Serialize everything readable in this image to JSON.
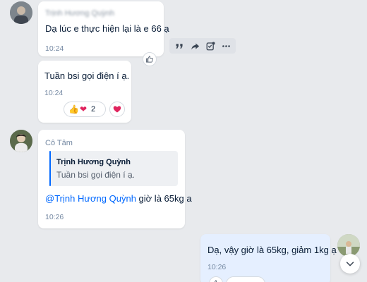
{
  "messages": [
    {
      "sender": "Trịnh Hương Quỳnh",
      "text": "Dạ lúc e thực hiện lại là e 66 ạ",
      "time": "10:24"
    },
    {
      "text": "Tuần bsi gọi điện í ạ.",
      "time": "10:24",
      "reaction_count": "2",
      "reaction_emojis": [
        "👍",
        "❤"
      ]
    },
    {
      "sender": "Cô Tâm",
      "quote_author": "Trịnh Hương Quỳnh",
      "quote_text": "Tuần bsi gọi điện í ạ.",
      "mention": "@Trịnh Hương Quỳnh",
      "text_after_mention": " giờ là 65kg a",
      "time": "10:26"
    },
    {
      "text": "Dạ, vậy giờ là 65kg, giảm 1kg ạ",
      "time": "10:26",
      "mine": true
    }
  ],
  "colors": {
    "background": "#e8eaed",
    "bubble": "#ffffff",
    "my_bubble": "#e5efff",
    "accent": "#0068ff",
    "heart": "#e0245e"
  },
  "icons": {
    "toolbar": [
      "quote-icon",
      "share-icon",
      "task-icon",
      "more-icon"
    ],
    "react": "thumbs-up-outline-icon",
    "scroll": "chevron-down-icon"
  }
}
